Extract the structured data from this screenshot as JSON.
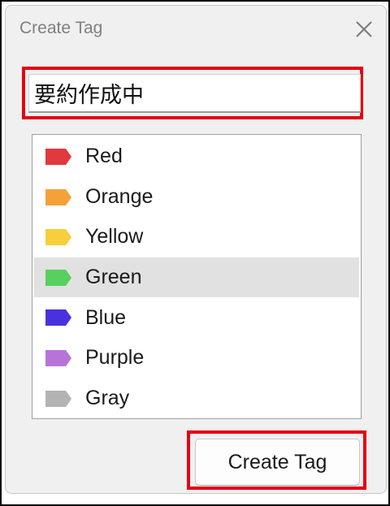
{
  "dialog": {
    "title": "Create Tag",
    "close_icon": "close-icon"
  },
  "tag_name": {
    "value": "要約作成中"
  },
  "colors": [
    {
      "label": "Red",
      "color": "#e0393e"
    },
    {
      "label": "Orange",
      "color": "#f5a13a"
    },
    {
      "label": "Yellow",
      "color": "#f7ce3b"
    },
    {
      "label": "Green",
      "color": "#57d05f"
    },
    {
      "label": "Blue",
      "color": "#4a31e0"
    },
    {
      "label": "Purple",
      "color": "#b873d8"
    },
    {
      "label": "Gray",
      "color": "#b3b3b3"
    }
  ],
  "selected_color": "Green",
  "actions": {
    "create_label": "Create Tag"
  },
  "highlight_color": "#e60012"
}
